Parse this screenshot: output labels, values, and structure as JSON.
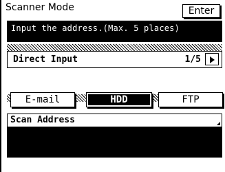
{
  "header": {
    "title": "Scanner Mode",
    "enter_label": "Enter"
  },
  "message": {
    "text": "Input the address.(Max. 5 places)"
  },
  "direct_input": {
    "label": "Direct Input",
    "page": "1/5"
  },
  "destinations": [
    {
      "label": "E-mail",
      "selected": false
    },
    {
      "label": "HDD",
      "selected": true
    },
    {
      "label": "FTP",
      "selected": false
    }
  ],
  "scan_address": {
    "label": "Scan Address",
    "value": ""
  },
  "colors": {
    "foreground": "#000000",
    "background": "#ffffff"
  }
}
